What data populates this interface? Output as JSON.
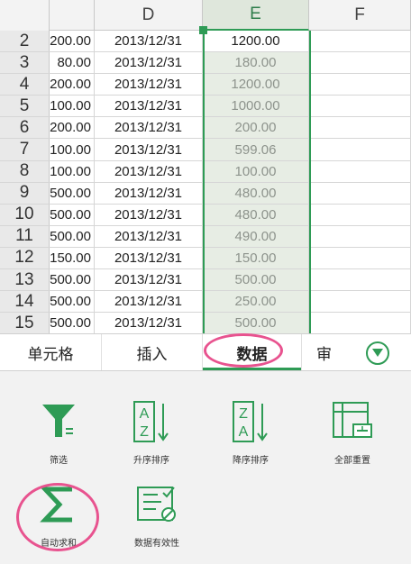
{
  "sheet": {
    "columns": [
      "D",
      "E",
      "F"
    ],
    "rows": [
      {
        "num": "2",
        "c": "200.00",
        "d": "2013/12/31",
        "e": "1200.00"
      },
      {
        "num": "3",
        "c": "80.00",
        "d": "2013/12/31",
        "e": "180.00"
      },
      {
        "num": "4",
        "c": "200.00",
        "d": "2013/12/31",
        "e": "1200.00"
      },
      {
        "num": "5",
        "c": "100.00",
        "d": "2013/12/31",
        "e": "1000.00"
      },
      {
        "num": "6",
        "c": "200.00",
        "d": "2013/12/31",
        "e": "200.00"
      },
      {
        "num": "7",
        "c": "100.00",
        "d": "2013/12/31",
        "e": "599.06"
      },
      {
        "num": "8",
        "c": "100.00",
        "d": "2013/12/31",
        "e": "100.00"
      },
      {
        "num": "9",
        "c": "500.00",
        "d": "2013/12/31",
        "e": "480.00"
      },
      {
        "num": "10",
        "c": "500.00",
        "d": "2013/12/31",
        "e": "480.00"
      },
      {
        "num": "11",
        "c": "500.00",
        "d": "2013/12/31",
        "e": "490.00"
      },
      {
        "num": "12",
        "c": "150.00",
        "d": "2013/12/31",
        "e": "150.00"
      },
      {
        "num": "13",
        "c": "500.00",
        "d": "2013/12/31",
        "e": "500.00"
      },
      {
        "num": "14",
        "c": "500.00",
        "d": "2013/12/31",
        "e": "250.00"
      },
      {
        "num": "15",
        "c": "500.00",
        "d": "2013/12/31",
        "e": "500.00"
      }
    ]
  },
  "tabs": {
    "cell": "单元格",
    "insert": "插入",
    "data": "数据",
    "review": "审"
  },
  "tools": {
    "filter": "筛选",
    "sort_asc": "升序排序",
    "sort_desc": "降序排序",
    "reset_all": "全部重置",
    "autosum": "自动求和",
    "validation": "数据有效性"
  },
  "colors": {
    "accent": "#2e9b55",
    "highlight": "#e8538f"
  }
}
